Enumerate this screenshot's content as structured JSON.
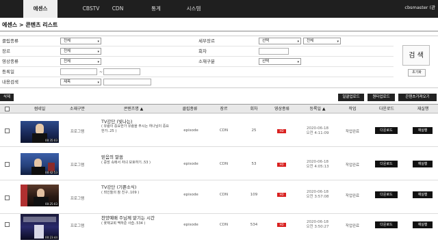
{
  "nav": {
    "tabs": [
      "에센스",
      "CBSTV",
      "CDN",
      "통계",
      "시스템"
    ],
    "active": "에센스",
    "user": "cbsmaster (관"
  },
  "breadcrumb": "에센스 > 콘텐츠 리스트",
  "filters": {
    "clip_type_label": "클립종류",
    "clip_type_value": "전체",
    "detail_genre_label": "세부장르",
    "detail_genre_value1": "선택",
    "detail_genre_value2": "전체",
    "genre_label": "장르",
    "genre_value": "전체",
    "episode_label": "회차",
    "video_type_label": "영상종류",
    "video_type_value": "전체",
    "subcategory_label": "소재구분",
    "subcategory_value": "선택",
    "reg_date_label": "등록일",
    "date_sep": "~",
    "content_search_label": "내용검색",
    "content_search_field": "제목",
    "search_button": "검 색",
    "reset_button": "초기화"
  },
  "toolbar": {
    "delete": "삭제",
    "batch_upload": "일괄업로드",
    "single_upload": "원타업로드",
    "fetch_content": "콘텐츠가져오기"
  },
  "table": {
    "headers": [
      "썸네일",
      "소재구분",
      "콘텐츠명 ▲",
      "클립종류",
      "장르",
      "회차",
      "영상종류",
      "등록일 ▲",
      "작업",
      "다운로드",
      "재실행"
    ],
    "rows": [
      {
        "duration": "00:35:03",
        "category": "프로그램",
        "title": "TV강단 (빛나는)",
        "subtitle": "( 유람이 중요한가 유람을 주시는 하나님이 중요한가..25 )",
        "clip": "episode",
        "genre": "CDN",
        "episode": "25",
        "hd": "HD",
        "date": "2020-06-18",
        "time": "오전 4:11:09",
        "work": "작업완료",
        "download": "다운로드",
        "rerun": "재실행"
      },
      {
        "duration": "00:42:53",
        "category": "프로그램",
        "title": "믿음의 말씀",
        "subtitle": "( 중망 속에서 자녀 보호하기..53 )",
        "clip": "episode",
        "genre": "CDN",
        "episode": "53",
        "hd": "HD",
        "date": "2020-06-18",
        "time": "오전 4:05:13",
        "work": "작업완료",
        "download": "다운로드",
        "rerun": "재실행"
      },
      {
        "duration": "00:25:03",
        "category": "프로그램",
        "title": "TV강단 (기쁜소식)",
        "subtitle": "( 죄인들의 참 친구..109 )",
        "clip": "episode",
        "genre": "CDN",
        "episode": "109",
        "hd": "HD",
        "date": "2020-06-18",
        "time": "오전 3:57:08",
        "work": "작업완료",
        "download": "다운로드",
        "rerun": "재실행"
      },
      {
        "duration": "00:23:44",
        "category": "프로그램",
        "title": "찬양예배 주님께 맡기는 시간",
        "subtitle": "( 꽃재교회 맥하준 사습..534 )",
        "clip": "episode",
        "genre": "CDN",
        "episode": "534",
        "hd": "HD",
        "date": "2020-06-18",
        "time": "오전 3:50:27",
        "work": "작업완료",
        "download": "다운로드",
        "rerun": "재실행"
      }
    ]
  },
  "colors": {
    "nav_bg": "#1f1f1f",
    "hd_badge": "#d9201f",
    "button_dark": "#111111"
  }
}
